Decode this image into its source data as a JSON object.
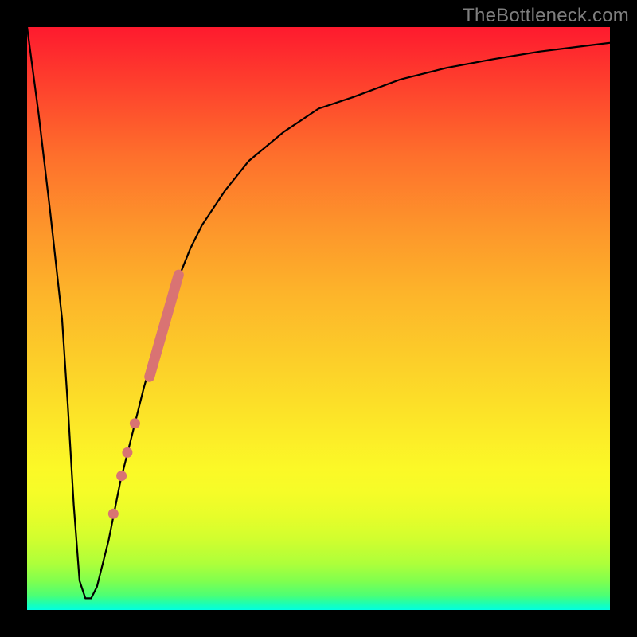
{
  "watermark": "TheBottleneck.com",
  "chart_data": {
    "type": "line",
    "title": "",
    "xlabel": "",
    "ylabel": "",
    "xlim": [
      0,
      100
    ],
    "ylim": [
      0,
      100
    ],
    "grid": false,
    "plot_background": "vertical gradient red→yellow→green (top→bottom)",
    "series": [
      {
        "name": "bottleneck-curve",
        "x": [
          0,
          2,
          4,
          6,
          7,
          8,
          9,
          10,
          11,
          12,
          14,
          16,
          18,
          20,
          22,
          24,
          26,
          28,
          30,
          34,
          38,
          44,
          50,
          56,
          64,
          72,
          80,
          88,
          96,
          100
        ],
        "y": [
          100,
          85,
          68,
          50,
          35,
          18,
          5,
          2,
          2,
          4,
          12,
          22,
          30,
          38,
          45,
          52,
          57,
          62,
          66,
          72,
          77,
          82,
          86,
          88,
          91,
          93,
          94.5,
          95.8,
          96.8,
          97.3
        ]
      }
    ],
    "valley": {
      "x_start": 9,
      "x_end": 10.5,
      "y": 2
    },
    "highlight_segment": {
      "name": "thick-salmon-bar",
      "x": [
        21.0,
        26.0
      ],
      "y": [
        40.0,
        57.5
      ]
    },
    "highlight_dots": [
      {
        "x": 18.5,
        "y": 32.0
      },
      {
        "x": 17.2,
        "y": 27.0
      },
      {
        "x": 16.2,
        "y": 23.0
      },
      {
        "x": 14.8,
        "y": 16.5
      }
    ],
    "colors": {
      "curve": "#000000",
      "markers": "#d97373",
      "frame": "#000000"
    }
  }
}
